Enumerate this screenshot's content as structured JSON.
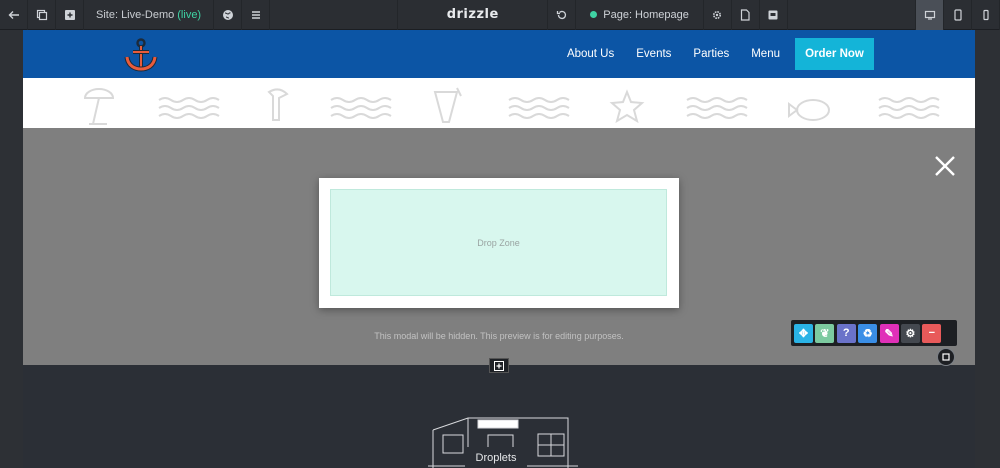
{
  "toolbar": {
    "site_prefix": "Site: Live-Demo",
    "site_status": "(live)",
    "logo": "drizzle",
    "page_label": "Page: Homepage"
  },
  "nav": {
    "links": [
      "About Us",
      "Events",
      "Parties",
      "Menu"
    ],
    "order_label": "Order Now"
  },
  "modal": {
    "dropzone_label": "Drop Zone",
    "hint": "This modal will be hidden. This preview is for editing purposes."
  },
  "footer": {
    "droplets_label": "Droplets"
  },
  "colors": {
    "nav_bg": "#0c55a5",
    "accent": "#14b4d8",
    "live": "#3fd3a4",
    "dropzone": "#d8f7ee"
  },
  "element_tools": [
    "move-icon",
    "leaf-icon",
    "help-icon",
    "recycle-icon",
    "brush-icon",
    "gear-icon",
    "remove-icon"
  ]
}
